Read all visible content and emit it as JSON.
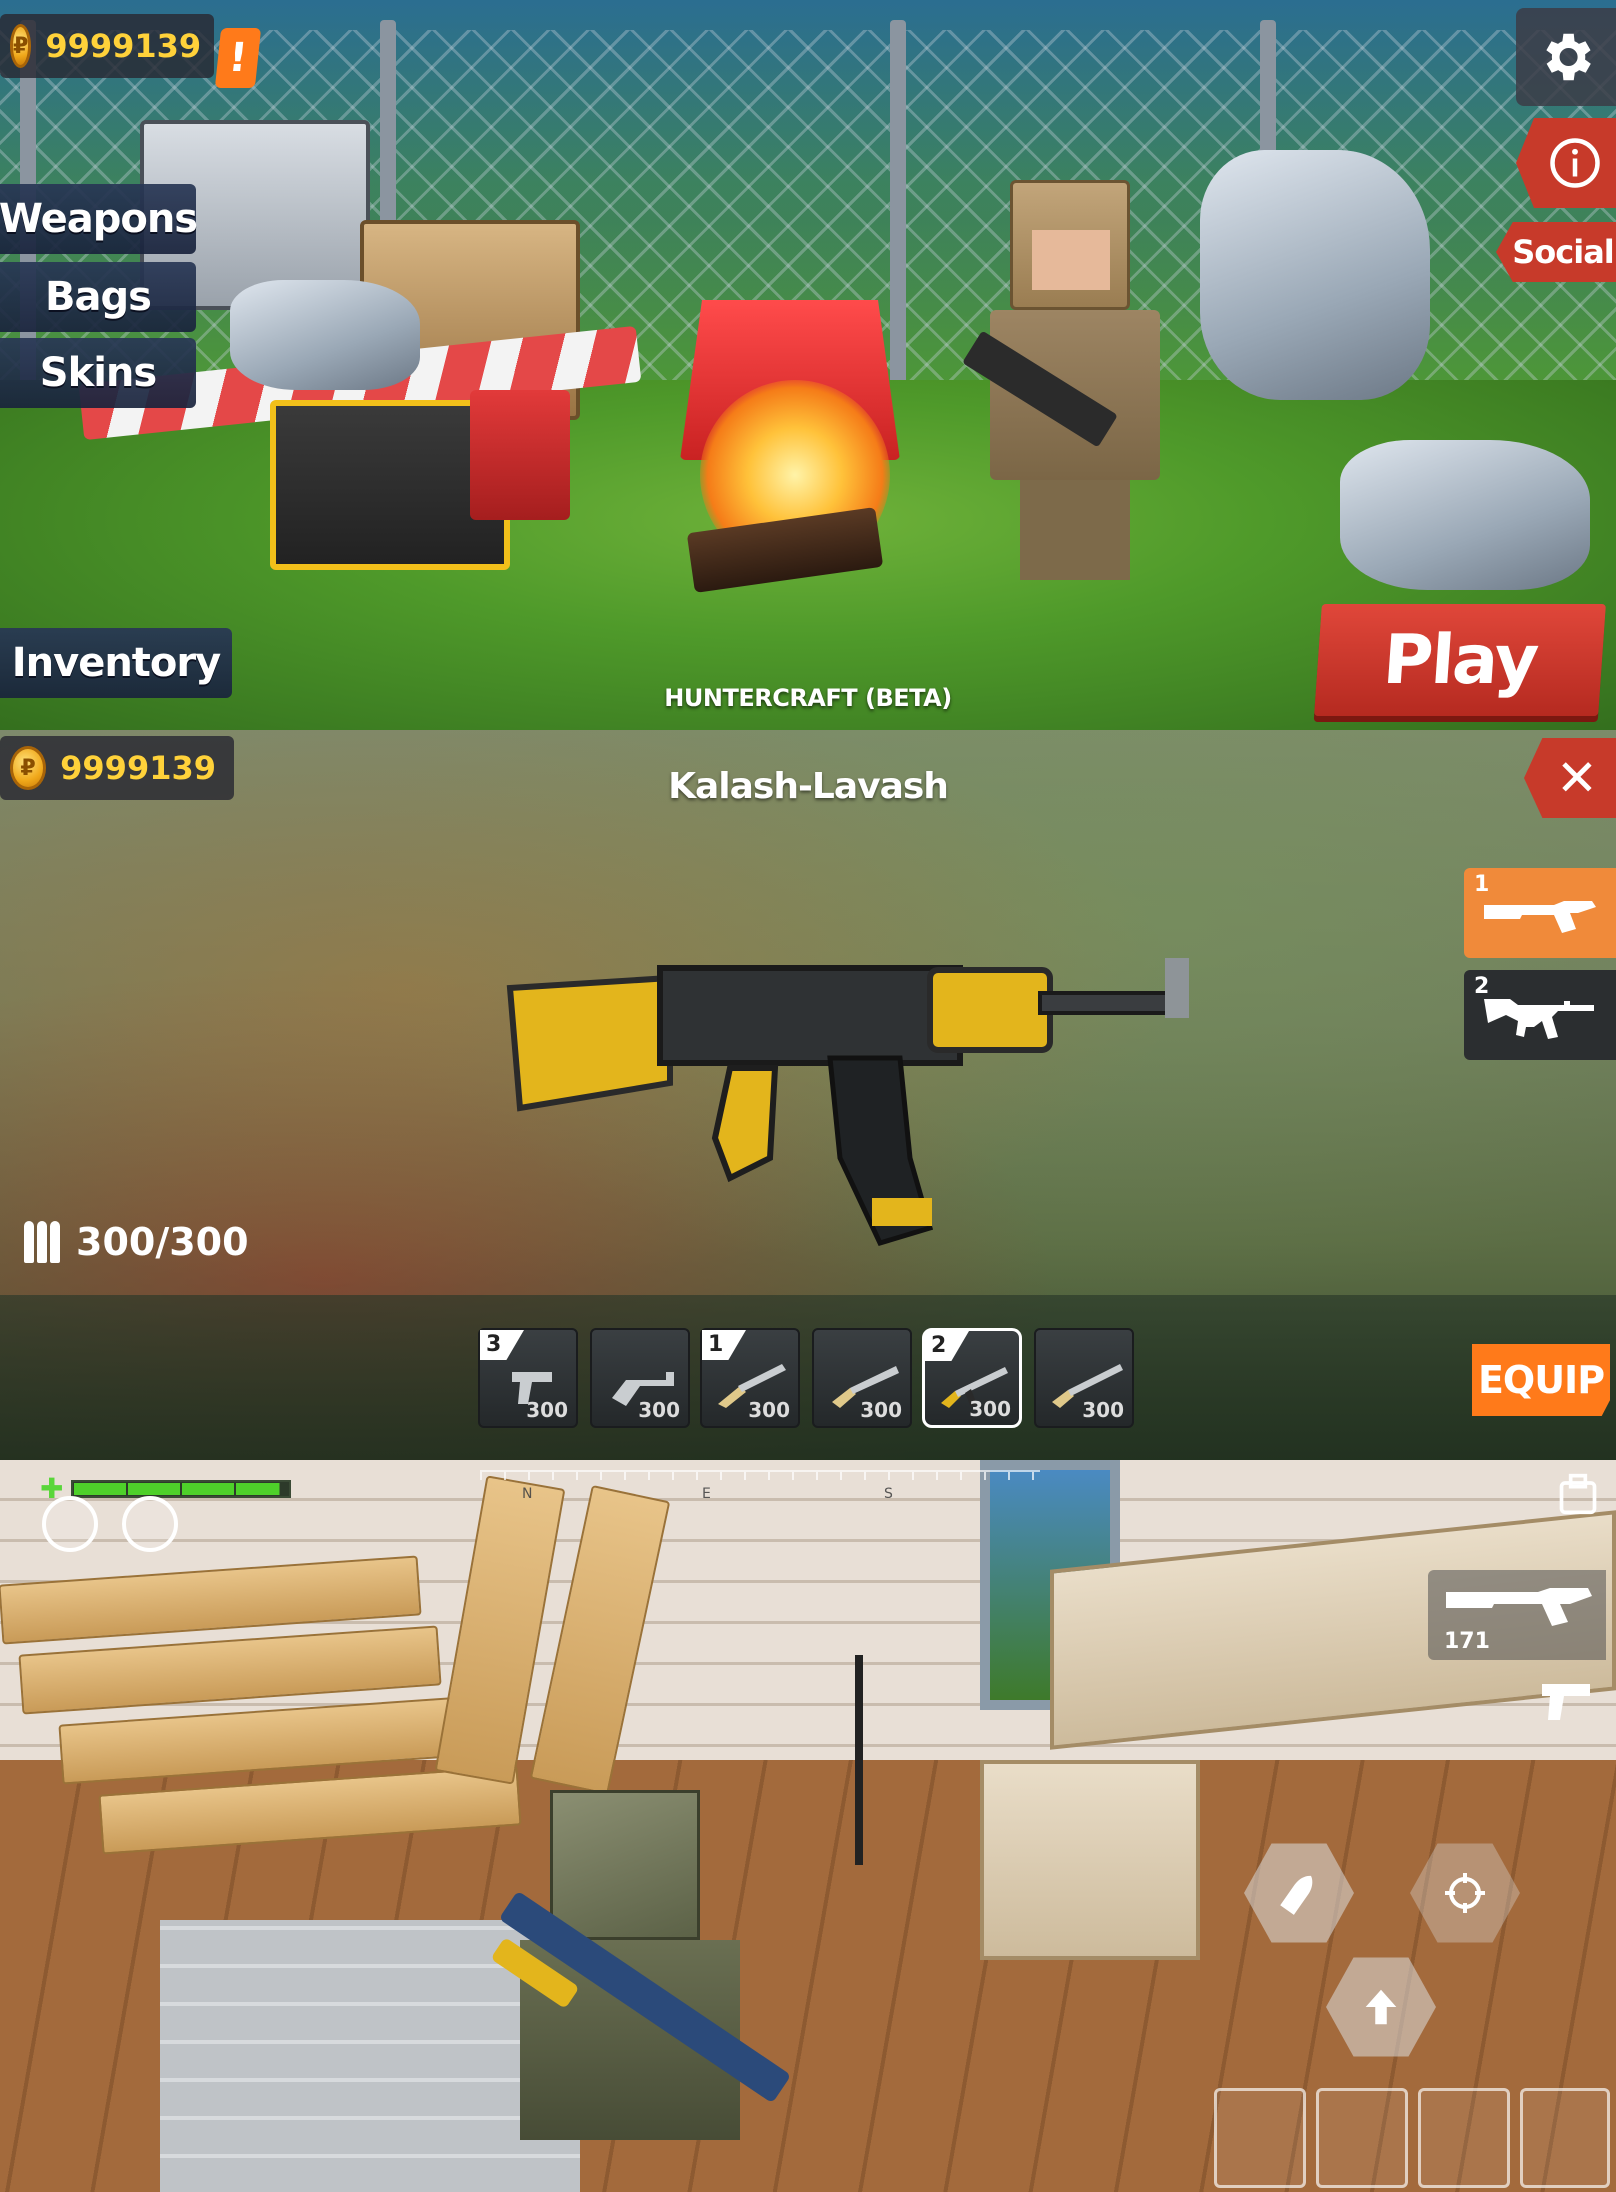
{
  "lobby": {
    "coins": "9999139",
    "alert_badge": "!",
    "menu": {
      "weapons": "Weapons",
      "bags": "Bags",
      "skins": "Skins",
      "inventory": "Inventory"
    },
    "social": "Social",
    "play": "Play",
    "game_title": "HUNTERCRAFT (BETA)"
  },
  "weapon_select": {
    "coins": "9999139",
    "weapon_name": "Kalash-Lavash",
    "slots": [
      {
        "number": "1",
        "icon": "shotgun-icon",
        "color": "#f08a3a"
      },
      {
        "number": "2",
        "icon": "assault-rifle-icon",
        "color": "#2b2e30"
      }
    ],
    "ammo": "300/300",
    "cards": [
      {
        "badge": "3",
        "icon": "pistol-icon",
        "count": "300",
        "selected": false
      },
      {
        "badge": "",
        "icon": "revolver-icon",
        "count": "300",
        "selected": false
      },
      {
        "badge": "1",
        "icon": "shotgun-icon",
        "count": "300",
        "selected": false
      },
      {
        "badge": "",
        "icon": "pump-shotgun-icon",
        "count": "300",
        "selected": false
      },
      {
        "badge": "2",
        "icon": "assault-rifle-icon",
        "count": "300",
        "selected": true
      },
      {
        "badge": "",
        "icon": "hunting-rifle-icon",
        "count": "300",
        "selected": false
      }
    ],
    "equip": "EQUIP"
  },
  "gameplay": {
    "health_fraction": 0.96,
    "compass": [
      "N",
      "E",
      "S"
    ],
    "ammo_count": "171",
    "colors": {
      "health": "#4ed02a",
      "accent": "#ff7a1a",
      "danger": "#c73a2a",
      "coin": "#ffd23a"
    }
  }
}
